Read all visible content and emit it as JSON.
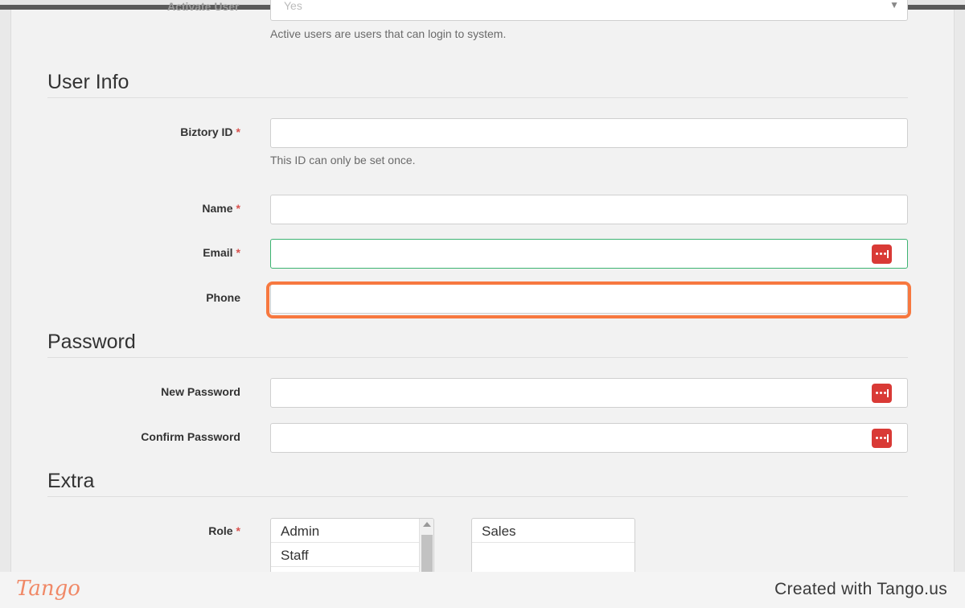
{
  "window": {
    "faded_label": "Activate User",
    "faded_value": "Yes"
  },
  "active_help": "Active users are users that can login to system.",
  "sections": {
    "user_info": "User Info",
    "password": "Password",
    "extra": "Extra"
  },
  "fields": {
    "biztory_id": {
      "label": "Biztory ID",
      "required": "*",
      "value": "",
      "help": "This ID can only be set once."
    },
    "name": {
      "label": "Name",
      "required": "*",
      "value": ""
    },
    "email": {
      "label": "Email",
      "required": "*",
      "value": ""
    },
    "phone": {
      "label": "Phone",
      "value": ""
    },
    "new_password": {
      "label": "New Password",
      "value": ""
    },
    "confirm_password": {
      "label": "Confirm Password",
      "value": ""
    },
    "role": {
      "label": "Role",
      "required": "*",
      "available": [
        "Admin",
        "Staff"
      ],
      "selected": [
        "Sales"
      ]
    }
  },
  "icons": {
    "password_manager": "password-manager-icon",
    "chevron": "chevron-down-icon",
    "scroll_up": "scroll-up-arrow-icon"
  },
  "colors": {
    "highlight": "#f7783f",
    "required": "#d9534f",
    "valid_border": "#3cb371",
    "password_manager": "#d93a36"
  },
  "footer": {
    "logo": "Tango",
    "credit": "Created with Tango.us"
  }
}
